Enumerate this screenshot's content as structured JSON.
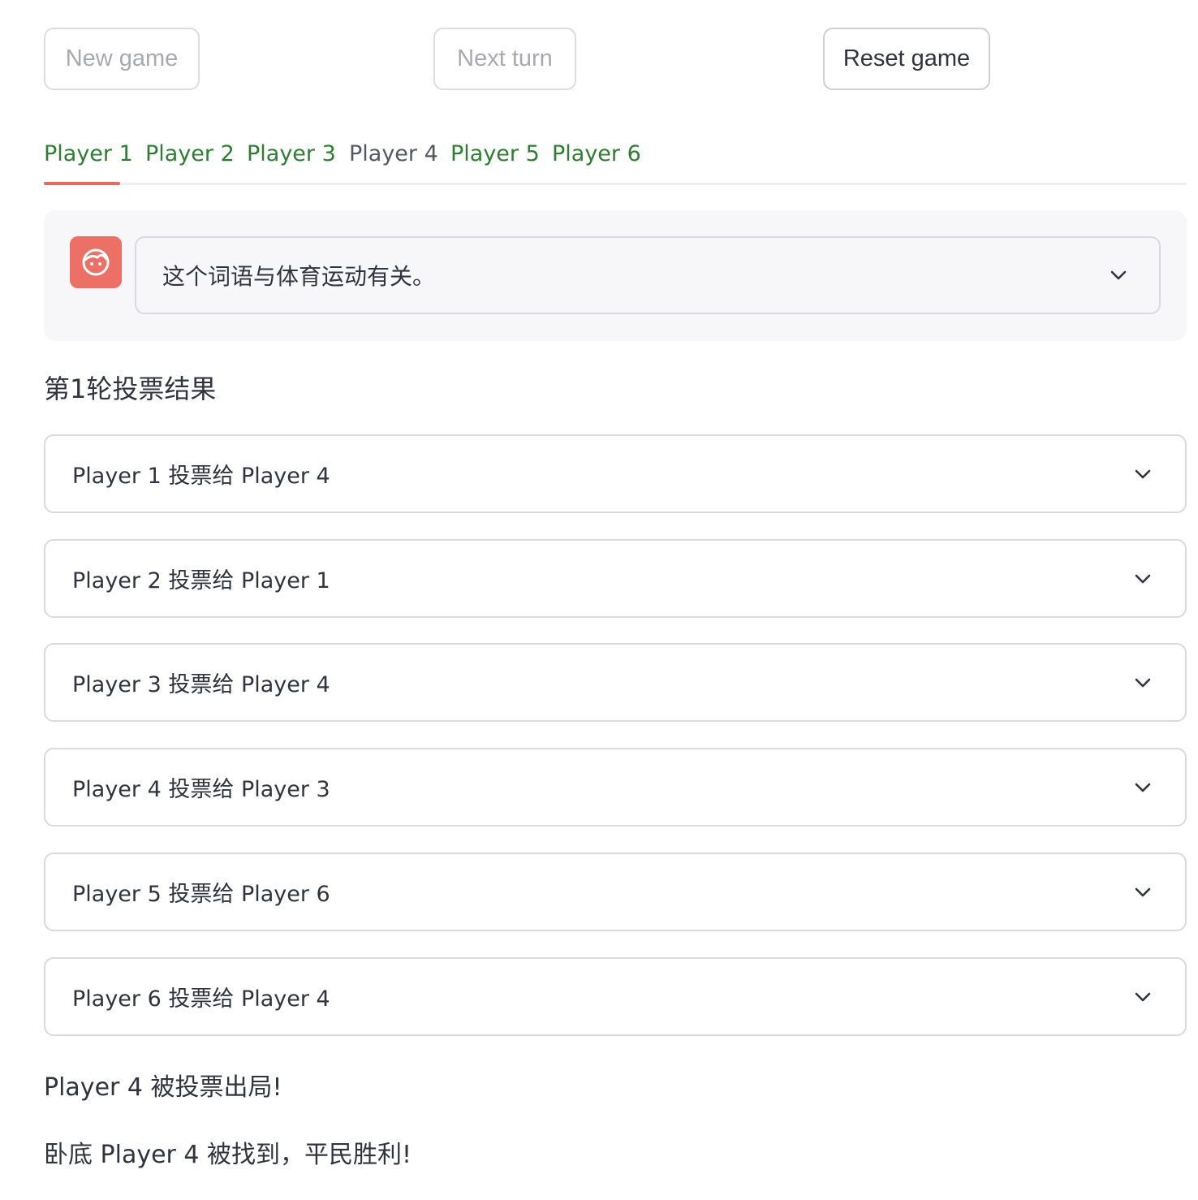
{
  "buttons": {
    "new_game": "New game",
    "next_turn": "Next turn",
    "reset_game": "Reset game"
  },
  "tabs": [
    {
      "label": "Player 1",
      "state": "active"
    },
    {
      "label": "Player 2",
      "state": "green"
    },
    {
      "label": "Player 3",
      "state": "green"
    },
    {
      "label": "Player 4",
      "state": "gray"
    },
    {
      "label": "Player 5",
      "state": "green"
    },
    {
      "label": "Player 6",
      "state": "green"
    }
  ],
  "chat": {
    "message": "这个词语与体育运动有关。",
    "avatar_icon": "face-icon"
  },
  "round_title": "第1轮投票结果",
  "votes": [
    {
      "label": "Player 1 投票给 Player 4"
    },
    {
      "label": "Player 2 投票给 Player 1"
    },
    {
      "label": "Player 3 投票给 Player 4"
    },
    {
      "label": "Player 4 投票给 Player 3"
    },
    {
      "label": "Player 5 投票给 Player 6"
    },
    {
      "label": "Player 6 投票给 Player 4"
    }
  ],
  "results": {
    "eliminated": "Player 4 被投票出局!",
    "outcome": "卧底 Player 4 被找到，平民胜利!"
  },
  "colors": {
    "tab_green": "#2e7d32",
    "tab_underline": "#e86a5c",
    "avatar_bg": "#ec7066"
  }
}
